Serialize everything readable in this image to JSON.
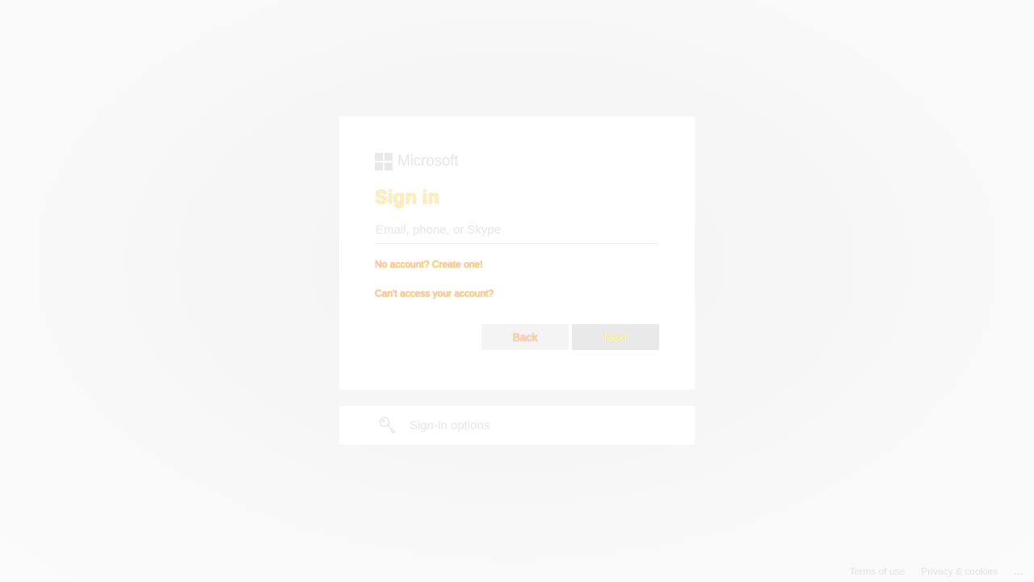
{
  "brand": {
    "name": "Microsoft"
  },
  "signin": {
    "title": "Sign in",
    "email_placeholder": "Email, phone, or Skype",
    "email_value": "",
    "no_account_link": "No account? Create one!",
    "cant_access_link": "Can't access your account?",
    "back_label": "Back",
    "next_label": "Next"
  },
  "options": {
    "label": "Sign-in options",
    "icon": "key-icon"
  },
  "footer": {
    "terms": "Terms of use",
    "privacy": "Privacy & cookies",
    "more": "..."
  },
  "colors": {
    "card_background": "#ffffff",
    "page_background": "#f6f6f6",
    "next_button": "#e9e9e9",
    "back_button": "#f4f4f4"
  }
}
